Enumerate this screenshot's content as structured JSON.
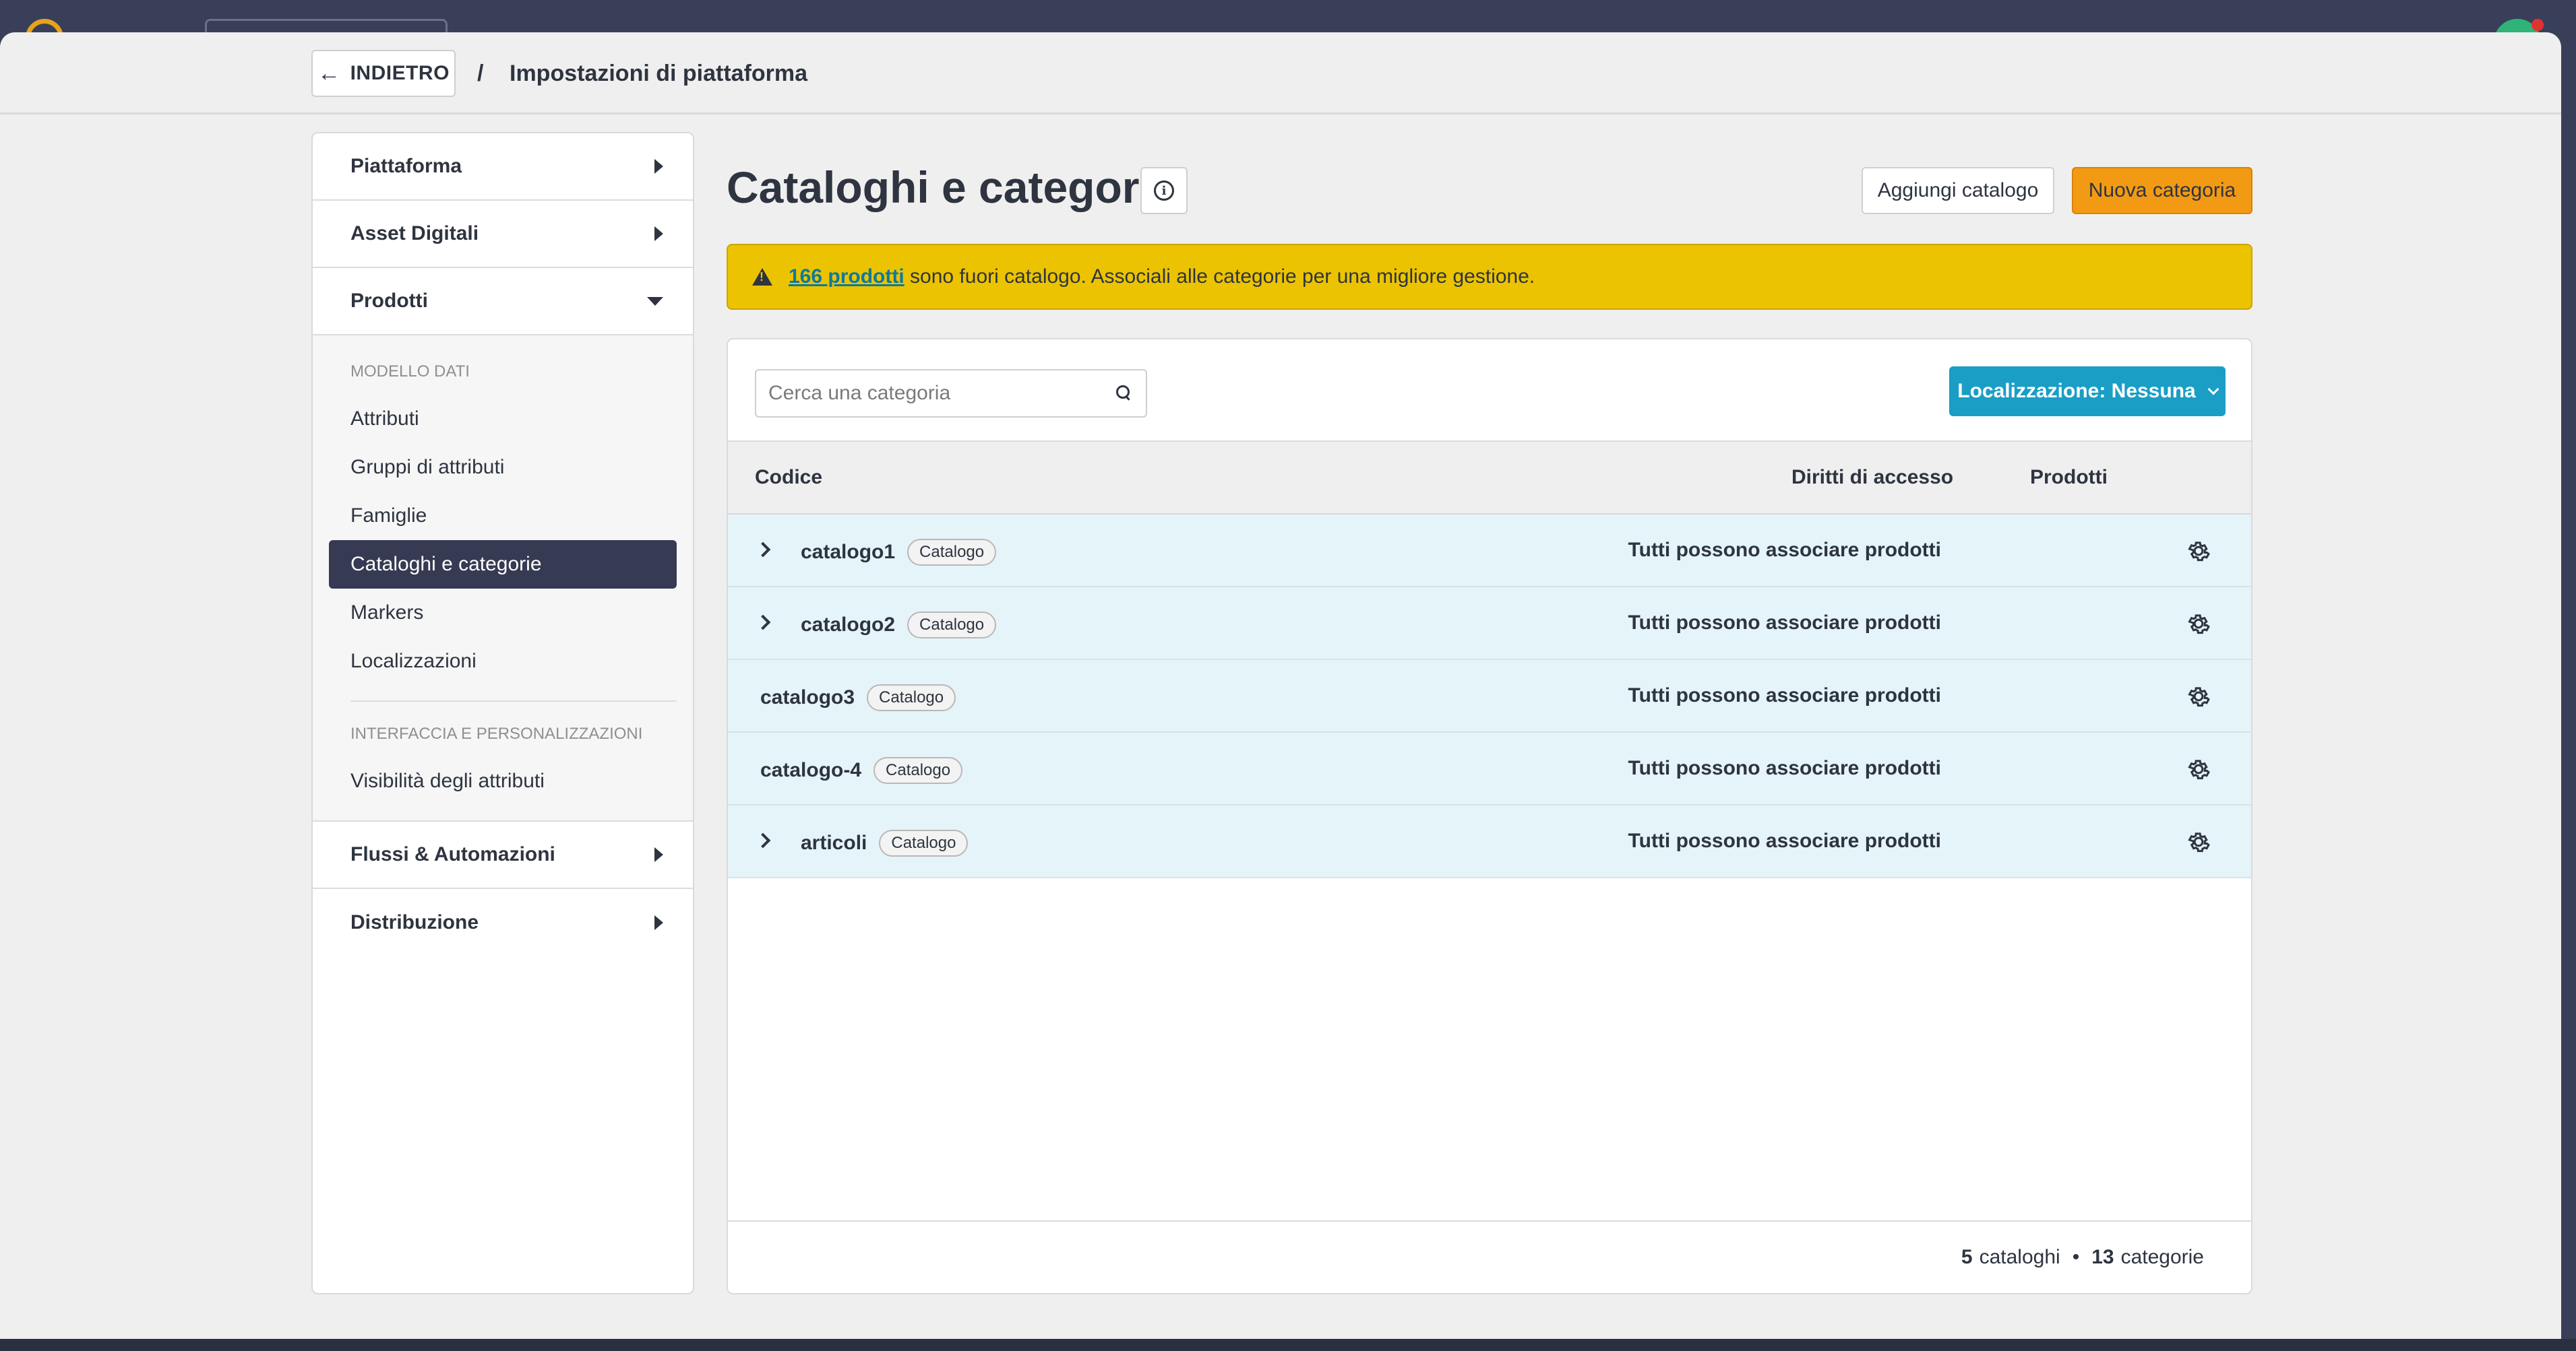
{
  "header": {
    "back_label": "INDIETRO",
    "separator": "/",
    "breadcrumb_title": "Impostazioni di piattaforma"
  },
  "sidebar": {
    "sections_top": [
      {
        "label": "Piattaforma",
        "expanded": false
      },
      {
        "label": "Asset Digitali",
        "expanded": false
      },
      {
        "label": "Prodotti",
        "expanded": true
      }
    ],
    "group1_heading": "MODELLO DATI",
    "group1_items": [
      {
        "label": "Attributi"
      },
      {
        "label": "Gruppi di attributi"
      },
      {
        "label": "Famiglie"
      },
      {
        "label": "Cataloghi e categorie",
        "active": true
      },
      {
        "label": "Markers"
      },
      {
        "label": "Localizzazioni"
      }
    ],
    "group2_heading": "INTERFACCIA E PERSONALIZZAZIONI",
    "group2_items": [
      {
        "label": "Visibilità degli attributi"
      }
    ],
    "sections_bottom": [
      {
        "label": "Flussi & Automazioni"
      },
      {
        "label": "Distribuzione"
      }
    ]
  },
  "main": {
    "title": "Cataloghi e categorie",
    "add_catalog_label": "Aggiungi catalogo",
    "new_category_label": "Nuova categoria",
    "alert": {
      "link_text": "166 prodotti",
      "message": "sono fuori catalogo. Associali alle categorie per una migliore gestione."
    },
    "search": {
      "placeholder": "Cerca una categoria",
      "value": ""
    },
    "localization_label": "Localizzazione: Nessuna",
    "columns": {
      "code": "Codice",
      "access": "Diritti di accesso",
      "products": "Prodotti"
    },
    "rows": [
      {
        "code": "catalogo1",
        "badge": "Catalogo",
        "access": "Tutti possono associare prodotti",
        "expandable": true
      },
      {
        "code": "catalogo2",
        "badge": "Catalogo",
        "access": "Tutti possono associare prodotti",
        "expandable": true
      },
      {
        "code": "catalogo3",
        "badge": "Catalogo",
        "access": "Tutti possono associare prodotti",
        "expandable": false
      },
      {
        "code": "catalogo-4",
        "badge": "Catalogo",
        "access": "Tutti possono associare prodotti",
        "expandable": false
      },
      {
        "code": "articoli",
        "badge": "Catalogo",
        "access": "Tutti possono associare prodotti",
        "expandable": true
      }
    ],
    "footer": {
      "catalog_count": "5",
      "catalog_word": "cataloghi",
      "bullet": "•",
      "category_count": "13",
      "category_word": "categorie"
    }
  },
  "colors": {
    "accent_orange": "#f29a14",
    "accent_blue": "#1a9ec6",
    "alert_yellow": "#ebc300",
    "row_highlight": "#e5f4f9",
    "active_nav": "#363a52"
  }
}
